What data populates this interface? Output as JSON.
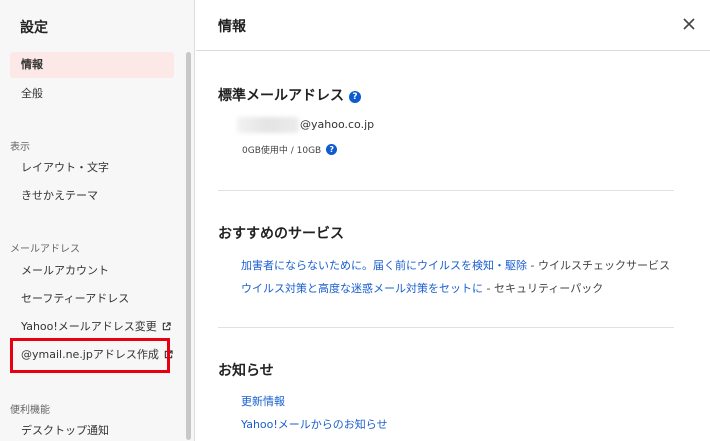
{
  "sidebar": {
    "title": "設定",
    "items": [
      {
        "label": "情報"
      },
      {
        "label": "全般"
      }
    ],
    "sections": [
      {
        "title": "表示",
        "items": [
          {
            "label": "レイアウト・文字"
          },
          {
            "label": "きせかえテーマ"
          }
        ]
      },
      {
        "title": "メールアドレス",
        "items": [
          {
            "label": "メールアカウント"
          },
          {
            "label": "セーフティーアドレス"
          },
          {
            "label": "Yahoo!メールアドレス変更"
          },
          {
            "label": "@ymail.ne.jpアドレス作成"
          }
        ]
      },
      {
        "title": "便利機能",
        "items": [
          {
            "label": "デスクトップ通知"
          }
        ]
      }
    ]
  },
  "main": {
    "title": "情報",
    "default_address": {
      "heading": "標準メールアドレス",
      "email_domain": "@yahoo.co.jp",
      "usage": "0GB使用中 / 10GB"
    },
    "recommended": {
      "heading": "おすすめのサービス",
      "items": [
        {
          "link": "加害者にならないために。届く前にウイルスを検知・駆除",
          "suffix": " - ウイルスチェックサービス"
        },
        {
          "link": "ウイルス対策と高度な迷惑メール対策をセットに",
          "suffix": " - セキュリティーパック"
        }
      ]
    },
    "notices": {
      "heading": "お知らせ",
      "items": [
        {
          "label": "更新情報"
        },
        {
          "label": "Yahoo!メールからのお知らせ"
        }
      ]
    }
  },
  "colors": {
    "accent_highlight": "#e60012",
    "active_item_bg": "#fde8e8",
    "link": "#1a5fcf",
    "help_icon": "#0d5bce"
  },
  "icons": [
    "close-icon",
    "help-icon",
    "external-link-icon"
  ]
}
